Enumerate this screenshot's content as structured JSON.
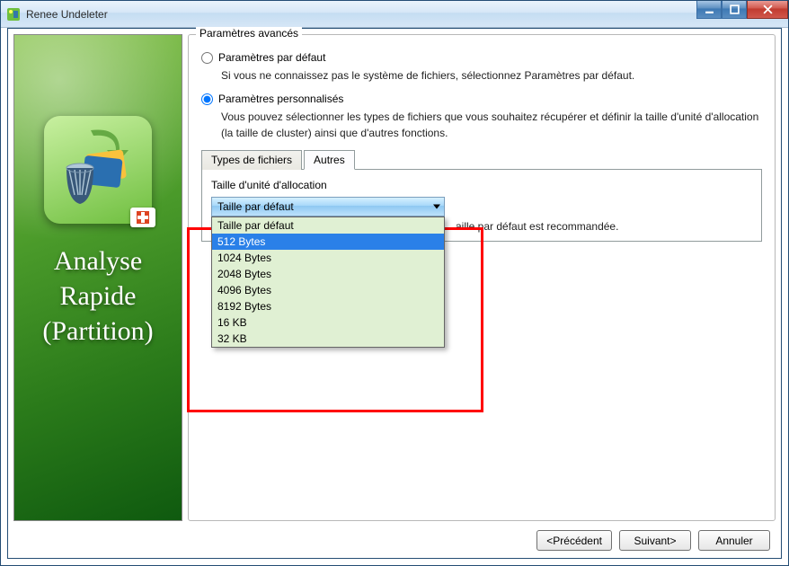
{
  "window": {
    "title": "Renee Undeleter"
  },
  "sidebar": {
    "headline_line1": "Analyse",
    "headline_line2": "Rapide",
    "headline_line3": "(Partition)"
  },
  "panel": {
    "legend": "Paramètres avancés",
    "default_label": "Paramètres par défaut",
    "default_desc": "Si vous ne connaissez pas le système de fichiers, sélectionnez Paramètres par défaut.",
    "custom_label": "Paramètres personnalisés",
    "custom_desc": "Vous pouvez sélectionner les types de fichiers que vous souhaitez récupérer et définir la taille d'unité d'allocation (la taille de cluster) ainsi que d'autres fonctions."
  },
  "tabs": {
    "filetypes": "Types de fichiers",
    "other": "Autres"
  },
  "alloc": {
    "label": "Taille d'unité d'allocation",
    "selected": "Taille par défaut",
    "options": [
      "Taille par défaut",
      "512 Bytes",
      "1024 Bytes",
      "2048 Bytes",
      "4096 Bytes",
      "8192 Bytes",
      "16 KB",
      "32 KB"
    ],
    "highlight_index": 1,
    "hint_suffix": "aille par défaut est recommandée."
  },
  "buttons": {
    "back": "<Précédent",
    "next": "Suivant>",
    "cancel": "Annuler"
  }
}
